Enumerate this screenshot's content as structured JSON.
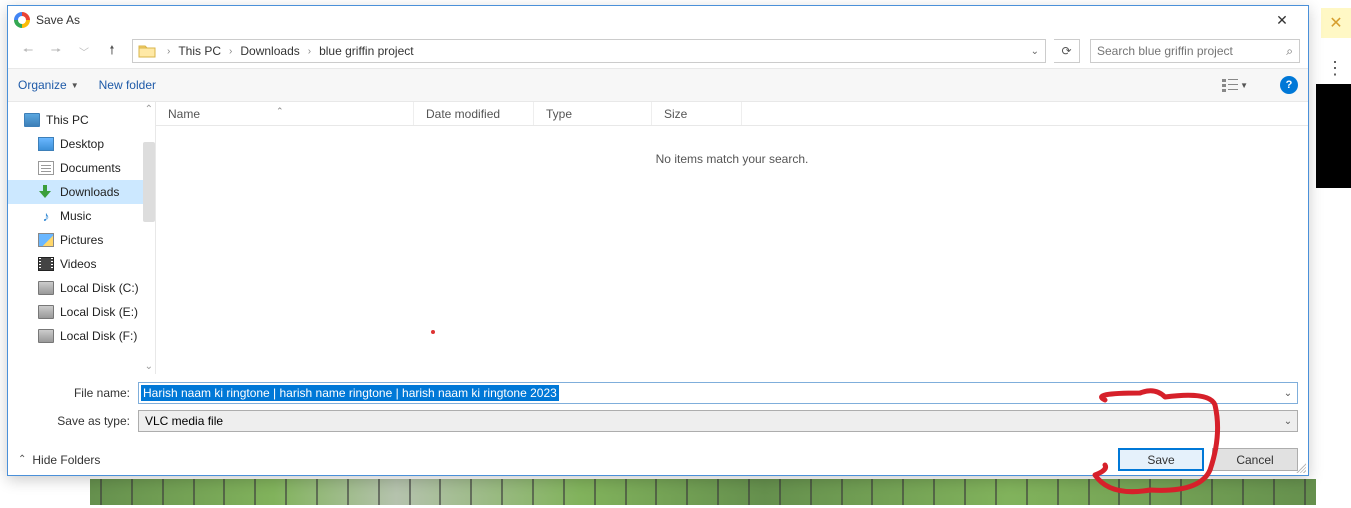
{
  "title": "Save As",
  "breadcrumb": {
    "root": "This PC",
    "mid": "Downloads",
    "leaf": "blue griffin project"
  },
  "search_placeholder": "Search blue griffin project",
  "toolbar": {
    "organize": "Organize",
    "newfolder": "New folder"
  },
  "tree": {
    "root": "This PC",
    "items": [
      {
        "label": "Desktop"
      },
      {
        "label": "Documents"
      },
      {
        "label": "Downloads"
      },
      {
        "label": "Music"
      },
      {
        "label": "Pictures"
      },
      {
        "label": "Videos"
      },
      {
        "label": "Local Disk (C:)"
      },
      {
        "label": "Local Disk (E:)"
      },
      {
        "label": "Local Disk (F:)"
      }
    ]
  },
  "columns": {
    "name": "Name",
    "date": "Date modified",
    "type": "Type",
    "size": "Size"
  },
  "empty": "No items match your search.",
  "fields": {
    "filename_label": "File name:",
    "filename_value": "Harish naam ki ringtone  |   harish name ringtone  |   harish naam ki ringtone 2023",
    "type_label": "Save as type:",
    "type_value": "VLC media file"
  },
  "footer": {
    "hide": "Hide Folders",
    "save": "Save",
    "cancel": "Cancel"
  }
}
